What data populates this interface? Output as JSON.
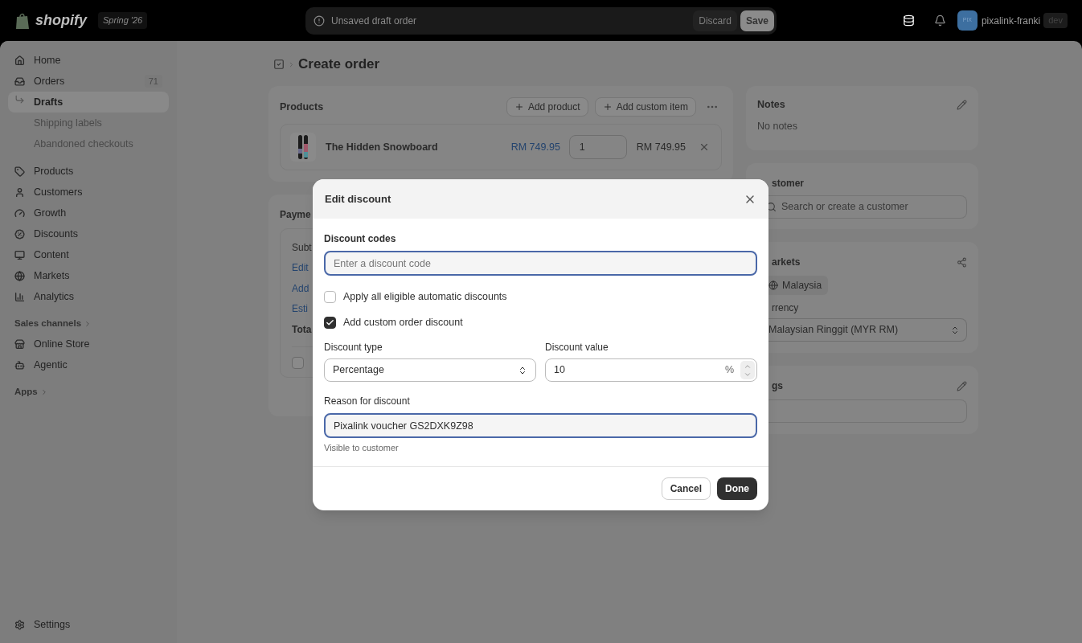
{
  "topbar": {
    "logo_text": "shopify",
    "version": "Spring '26",
    "status": "Unsaved draft order",
    "buttons": [
      {
        "label": "Discard",
        "kind": "secondary"
      },
      {
        "label": "Save",
        "kind": "primary"
      }
    ],
    "account": {
      "initials": "PIX",
      "name": "pixalink-franki",
      "badge": "dev"
    }
  },
  "sidebar": {
    "items": [
      {
        "label": "Home",
        "selected": false
      },
      {
        "label": "Orders",
        "badge": "71",
        "selected": false,
        "children": [
          {
            "label": "Drafts",
            "selected": true
          },
          {
            "label": "Shipping labels",
            "selected": false
          },
          {
            "label": "Abandoned checkouts",
            "selected": false
          }
        ]
      },
      {
        "label": "Products",
        "selected": false
      },
      {
        "label": "Customers",
        "selected": false
      },
      {
        "label": "Growth",
        "selected": false
      },
      {
        "label": "Discounts",
        "selected": false
      },
      {
        "label": "Content",
        "selected": false
      },
      {
        "label": "Markets",
        "selected": false
      },
      {
        "label": "Analytics",
        "selected": false
      }
    ],
    "sections": [
      {
        "label": "Sales channels",
        "items": [
          {
            "label": "Online Store",
            "selected": false
          },
          {
            "label": "Agentic",
            "selected": false
          }
        ]
      },
      {
        "label": "Apps"
      }
    ],
    "settings": "Settings"
  },
  "page": {
    "title": "Create order"
  },
  "products": {
    "title": "Products",
    "buttons": [
      "Add product",
      "Add custom item"
    ],
    "line_item": {
      "name": "The Hidden Snowboard",
      "price": "RM 749.95",
      "quantity": "1",
      "total": "RM 749.95"
    }
  },
  "payment": {
    "title": "Payme",
    "rows": [
      {
        "label": "Subt",
        "kind": "text"
      },
      {
        "label": "Edit",
        "kind": "link"
      },
      {
        "label": "Add",
        "kind": "link"
      },
      {
        "label": "Esti",
        "kind": "link"
      },
      {
        "label": "Tota",
        "kind": "bold"
      }
    ],
    "checkbox": {
      "checked": false
    }
  },
  "notes": {
    "title": "Notes",
    "text": "No notes"
  },
  "customer": {
    "title": "stomer",
    "placeholder": "Search or create a customer"
  },
  "markets": {
    "title": "arkets",
    "chip": "Malaysia",
    "currency_label": "rrency",
    "currency": "Malaysian Ringgit (MYR RM)"
  },
  "tags": {
    "title": "gs"
  },
  "modal": {
    "title": "Edit discount",
    "codes": {
      "label": "Discount codes",
      "placeholder": "Enter a discount code"
    },
    "options": [
      {
        "label": "Apply all eligible automatic discounts",
        "checked": false
      },
      {
        "label": "Add custom order discount",
        "checked": true
      }
    ],
    "type": {
      "label": "Discount type",
      "value": "Percentage"
    },
    "value": {
      "label": "Discount value",
      "value": "10",
      "suffix": "%"
    },
    "reason": {
      "label": "Reason for discount",
      "value": "Pixalink voucher GS2DXK9Z98",
      "help": "Visible to customer"
    },
    "buttons": [
      {
        "label": "Cancel",
        "kind": "secondary"
      },
      {
        "label": "Done",
        "kind": "primary"
      }
    ]
  }
}
